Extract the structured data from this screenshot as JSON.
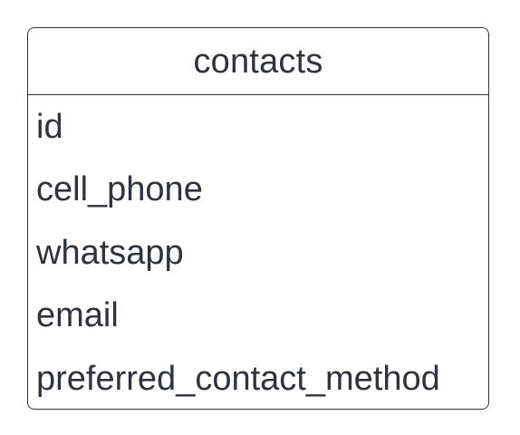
{
  "entity": {
    "title": "contacts",
    "fields": [
      {
        "name": "id"
      },
      {
        "name": "cell_phone"
      },
      {
        "name": "whatsapp"
      },
      {
        "name": "email"
      },
      {
        "name": "preferred_contact_method"
      }
    ]
  },
  "colors": {
    "border": "#2f333d",
    "text": "#2f333d",
    "background": "#ffffff"
  }
}
